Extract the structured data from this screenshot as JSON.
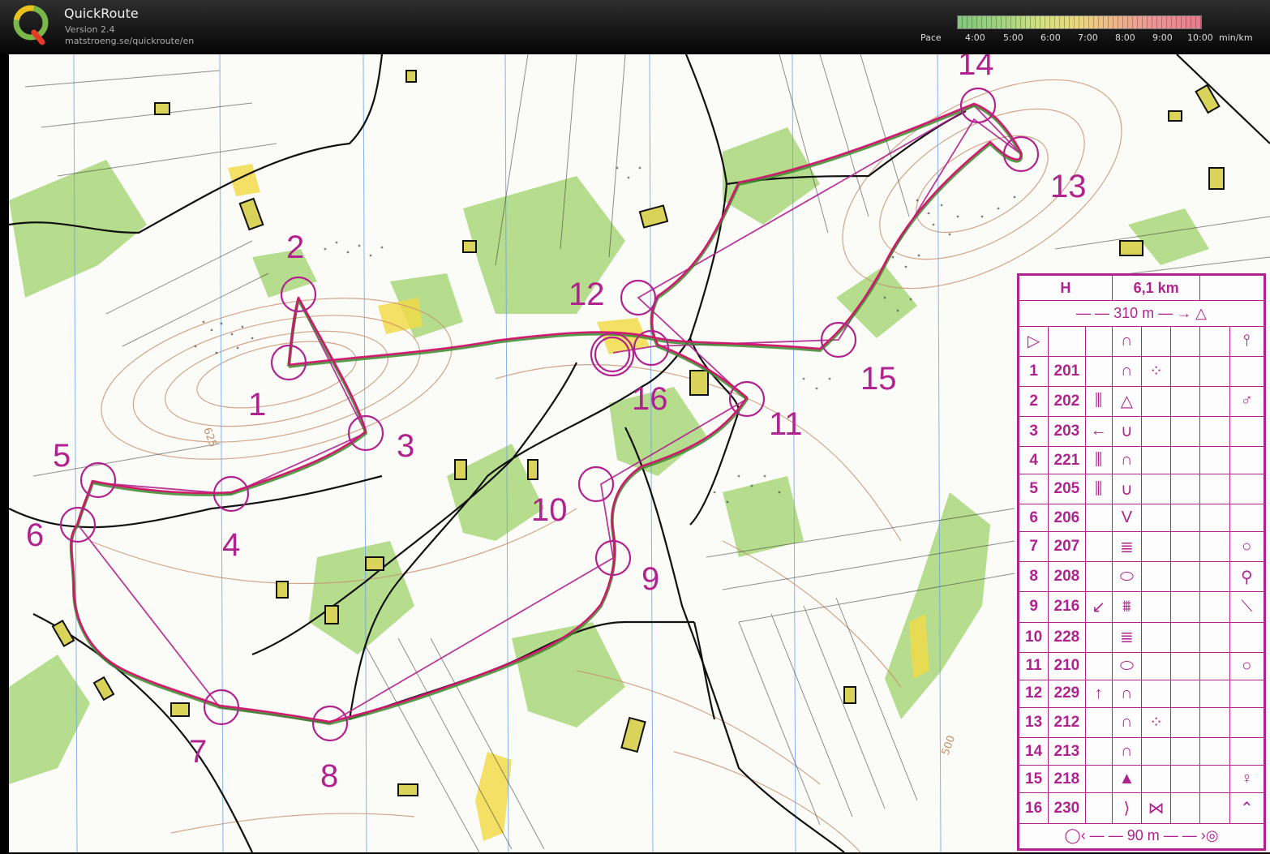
{
  "header": {
    "app_name": "QuickRoute",
    "version": "Version 2.4",
    "url": "matstroeng.se/quickroute/en",
    "pace_label": "Pace",
    "pace_ticks": [
      "4:00",
      "5:00",
      "6:00",
      "7:00",
      "8:00",
      "9:00",
      "10:00"
    ],
    "pace_unit": "min/km"
  },
  "map": {
    "route_color": "#d4146e",
    "course_color": "#b0238f",
    "controls": [
      {
        "n": "1"
      },
      {
        "n": "2"
      },
      {
        "n": "3"
      },
      {
        "n": "4"
      },
      {
        "n": "5"
      },
      {
        "n": "6"
      },
      {
        "n": "7"
      },
      {
        "n": "8"
      },
      {
        "n": "9"
      },
      {
        "n": "10"
      },
      {
        "n": "11"
      },
      {
        "n": "12"
      },
      {
        "n": "13"
      },
      {
        "n": "14"
      },
      {
        "n": "15"
      },
      {
        "n": "16"
      }
    ],
    "contour_label_a": "625",
    "contour_label_b": "500"
  },
  "description_sheet": {
    "class": "H",
    "length": "6,1 km",
    "start_text": "310 m",
    "finish_text": "90 m",
    "rows": [
      {
        "num": "1",
        "code": "201",
        "c": "",
        "d": "∩",
        "e": "⁘",
        "f": ""
      },
      {
        "num": "2",
        "code": "202",
        "c": "⫼",
        "d": "△",
        "e": "",
        "f": "♂"
      },
      {
        "num": "3",
        "code": "203",
        "c": "←",
        "d": "∪",
        "e": "",
        "f": ""
      },
      {
        "num": "4",
        "code": "221",
        "c": "⫼",
        "d": "∩",
        "e": "",
        "f": ""
      },
      {
        "num": "5",
        "code": "205",
        "c": "⫼",
        "d": "∪",
        "e": "",
        "f": ""
      },
      {
        "num": "6",
        "code": "206",
        "c": "",
        "d": "V",
        "e": "",
        "f": ""
      },
      {
        "num": "7",
        "code": "207",
        "c": "",
        "d": "≣",
        "e": "",
        "f": "○"
      },
      {
        "num": "8",
        "code": "208",
        "c": "",
        "d": "⬭",
        "e": "",
        "f": "⚲"
      },
      {
        "num": "9",
        "code": "216",
        "c": "↙",
        "d": "⩩",
        "e": "",
        "f": "⟍"
      },
      {
        "num": "10",
        "code": "228",
        "c": "",
        "d": "≣",
        "e": "",
        "f": ""
      },
      {
        "num": "11",
        "code": "210",
        "c": "",
        "d": "⬭",
        "e": "",
        "f": "○"
      },
      {
        "num": "12",
        "code": "229",
        "c": "↑",
        "d": "∩",
        "e": "",
        "f": ""
      },
      {
        "num": "13",
        "code": "212",
        "c": "",
        "d": "∩",
        "e": "⁘",
        "f": ""
      },
      {
        "num": "14",
        "code": "213",
        "c": "",
        "d": "∩",
        "e": "",
        "f": ""
      },
      {
        "num": "15",
        "code": "218",
        "c": "",
        "d": "▲",
        "e": "",
        "f": "♀"
      },
      {
        "num": "16",
        "code": "230",
        "c": "",
        "d": "⟩",
        "e": "⋈",
        "f": "⌃"
      }
    ]
  }
}
